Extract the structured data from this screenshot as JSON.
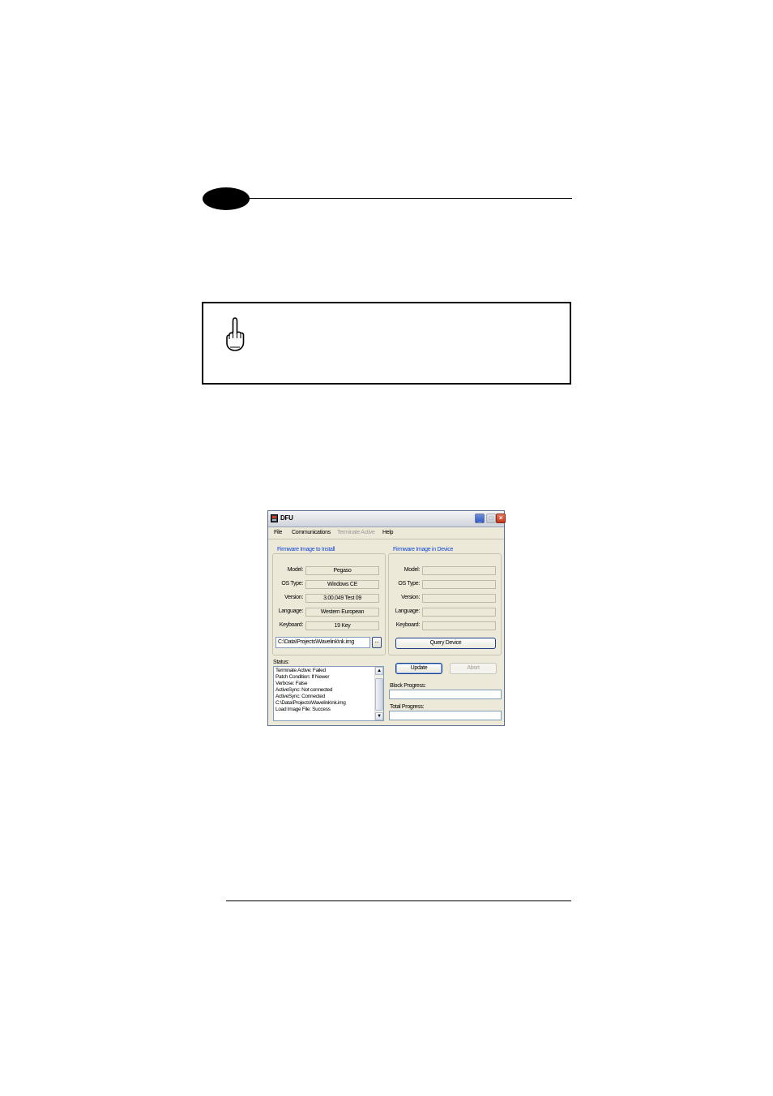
{
  "window": {
    "title": "DFU",
    "minimize_glyph": "_",
    "maximize_glyph": "□",
    "close_glyph": "×"
  },
  "menu": {
    "file": "File",
    "communications": "Communications",
    "terminate_active": "Terminate Active",
    "help": "Help"
  },
  "install_group": {
    "title": "Firmware Image to Install",
    "fields": [
      {
        "label": "Model:",
        "value": "Pegaso"
      },
      {
        "label": "OS Type:",
        "value": "Windows CE"
      },
      {
        "label": "Version:",
        "value": "3.00.049 Test 09"
      },
      {
        "label": "Language:",
        "value": "Western European"
      },
      {
        "label": "Keyboard:",
        "value": "19 Key"
      }
    ],
    "path": "C:\\Data\\Projects\\Wavelink\\nk.img",
    "browse_label": "..."
  },
  "device_group": {
    "title": "Firmware Image in Device",
    "fields": [
      {
        "label": "Model:",
        "value": ""
      },
      {
        "label": "OS Type:",
        "value": ""
      },
      {
        "label": "Version:",
        "value": ""
      },
      {
        "label": "Language:",
        "value": ""
      },
      {
        "label": "Keyboard:",
        "value": ""
      }
    ],
    "query_label": "Query Device"
  },
  "actions": {
    "update_label": "Update",
    "abort_label": "Abort"
  },
  "status": {
    "label": "Status:",
    "lines": [
      "Terminate Active: Failed",
      "Patch Condition: If Newer",
      "Verbose: False",
      "ActiveSync: Not connected",
      "ActiveSync: Connected",
      "C:\\Data\\Projects\\Wavelink\\nk.img",
      "Load Image File: Success"
    ],
    "scroll_up": "▲",
    "scroll_down": "▼"
  },
  "progress": {
    "block_label": "Block Progress:",
    "total_label": "Total Progress:",
    "block_value": 0,
    "total_value": 0
  },
  "icons": {
    "note": "pointing-hand-icon",
    "app": "dfu-app-icon"
  }
}
